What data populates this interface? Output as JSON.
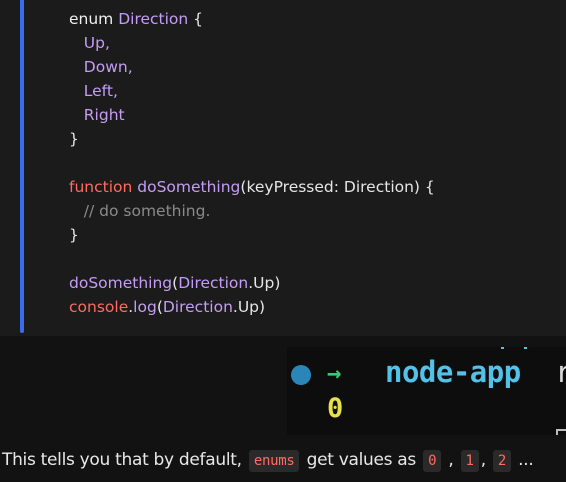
{
  "code": {
    "lines": [
      [
        {
          "t": "enum ",
          "c": "kw"
        },
        {
          "t": "Direction",
          "c": "ident"
        },
        {
          "t": " {",
          "c": "plain"
        }
      ],
      [
        {
          "t": "   Up,",
          "c": "ident"
        }
      ],
      [
        {
          "t": "   Down,",
          "c": "ident"
        }
      ],
      [
        {
          "t": "   Left,",
          "c": "ident"
        }
      ],
      [
        {
          "t": "   Right",
          "c": "ident"
        }
      ],
      [
        {
          "t": "}",
          "c": "plain"
        }
      ],
      [],
      [
        {
          "t": "function ",
          "c": "kw-fn"
        },
        {
          "t": "doSomething",
          "c": "ident"
        },
        {
          "t": "(keyPressed: Direction) {",
          "c": "plain"
        }
      ],
      [
        {
          "t": "   // do something.",
          "c": "comment"
        }
      ],
      [
        {
          "t": "}",
          "c": "plain"
        }
      ],
      [],
      [
        {
          "t": "doSomething",
          "c": "ident"
        },
        {
          "t": "(",
          "c": "plain"
        },
        {
          "t": "Direction",
          "c": "ident"
        },
        {
          "t": ".Up)",
          "c": "plain"
        }
      ],
      [
        {
          "t": "console",
          "c": "con"
        },
        {
          "t": ".",
          "c": "plain"
        },
        {
          "t": "log",
          "c": "ident"
        },
        {
          "t": "(",
          "c": "plain"
        },
        {
          "t": "Direction",
          "c": "ident"
        },
        {
          "t": ".Up)",
          "c": "plain"
        }
      ]
    ]
  },
  "terminal": {
    "arrow": "→",
    "app": "node-app",
    "trailing": "r",
    "output": "0"
  },
  "prose": {
    "before": "This tells you that by default, ",
    "code_enums": "enums",
    "middle": " get values as ",
    "v0": "0",
    "comma1": " , ",
    "v1": "1",
    "comma2": ", ",
    "v2": "2",
    "ellipsis": " ..."
  },
  "colors": {
    "accent": "#3b6bf0",
    "keyword": "#ff6b5f",
    "identifier": "#c59df5",
    "terminal_app": "#54c1e8",
    "terminal_arrow": "#38c974",
    "terminal_output": "#e6e24a"
  }
}
